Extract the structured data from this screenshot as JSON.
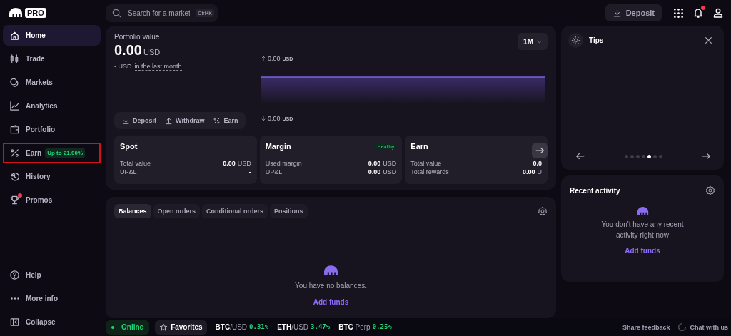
{
  "logo": {
    "badge": "PRO"
  },
  "sidebar": {
    "items": [
      {
        "label": "Home",
        "selected": true,
        "highlighted": false,
        "notification": false
      },
      {
        "label": "Trade",
        "selected": false,
        "highlighted": false,
        "notification": false
      },
      {
        "label": "Markets",
        "selected": false,
        "highlighted": false,
        "notification": false
      },
      {
        "label": "Analytics",
        "selected": false,
        "highlighted": false,
        "notification": false
      },
      {
        "label": "Portfolio",
        "selected": false,
        "highlighted": false,
        "notification": false
      },
      {
        "label": "Earn",
        "tag": "Up to 21.00%",
        "selected": false,
        "highlighted": true,
        "notification": false
      },
      {
        "label": "History",
        "selected": false,
        "highlighted": false,
        "notification": false
      },
      {
        "label": "Promos",
        "selected": false,
        "highlighted": false,
        "notification": true
      }
    ],
    "footer_items": [
      {
        "label": "Help"
      },
      {
        "label": "More info"
      },
      {
        "label": "Collapse"
      }
    ]
  },
  "search": {
    "placeholder": "Search for a market",
    "shortcut": "Ctrl+K"
  },
  "header": {
    "deposit_button": "Deposit",
    "notification": true
  },
  "portfolio": {
    "title": "Portfolio value",
    "value": "0.00",
    "currency": "USD",
    "change": "- USD",
    "period": "in the last month",
    "range": "1M",
    "high": "0.00",
    "high_unit": "USD",
    "low": "0.00",
    "low_unit": "USD",
    "actions": [
      "Deposit",
      "Withdraw",
      "Earn"
    ]
  },
  "accounts": [
    {
      "title": "Spot",
      "rows": [
        {
          "label": "Total value",
          "value": "0.00",
          "unit": "USD"
        },
        {
          "label": "UP&L",
          "value": "-"
        }
      ]
    },
    {
      "title": "Margin",
      "status": "Healthy",
      "rows": [
        {
          "label": "Used margin",
          "value": "0.00",
          "unit": "USD"
        },
        {
          "label": "UP&L",
          "value": "0.00",
          "unit": "USD"
        }
      ]
    },
    {
      "title": "Earn",
      "rows": [
        {
          "label": "Total value",
          "value": "0.0"
        },
        {
          "label": "Total rewards",
          "value": "0.00",
          "unit": "U"
        }
      ]
    }
  ],
  "tips": {
    "title": "Tips",
    "dots": [
      {
        "selected": false
      },
      {
        "selected": false
      },
      {
        "selected": false
      },
      {
        "selected": false
      },
      {
        "selected": true
      },
      {
        "selected": false
      },
      {
        "selected": false
      }
    ]
  },
  "holdings": {
    "tabs": [
      {
        "label": "Balances",
        "selected": true
      },
      {
        "label": "Open orders",
        "selected": false
      },
      {
        "label": "Conditional orders",
        "selected": false
      },
      {
        "label": "Positions",
        "selected": false
      }
    ],
    "empty_text": "You have no balances.",
    "link": "Add funds"
  },
  "recent_activity": {
    "title": "Recent activity",
    "empty_text": "You don't have any recent activity right now",
    "link": "Add funds"
  },
  "status_bar": {
    "status": "Online",
    "favorites": "Favorites",
    "tickers": [
      {
        "pair": "**BTC**/USD",
        "change": "0.31%"
      },
      {
        "pair": "**ETH**/USD",
        "change": "3.47%"
      },
      {
        "pair": "**BTC** Perp",
        "change": "0.25%"
      }
    ],
    "feedback": "Share feedback",
    "chat": "Chat with us"
  }
}
